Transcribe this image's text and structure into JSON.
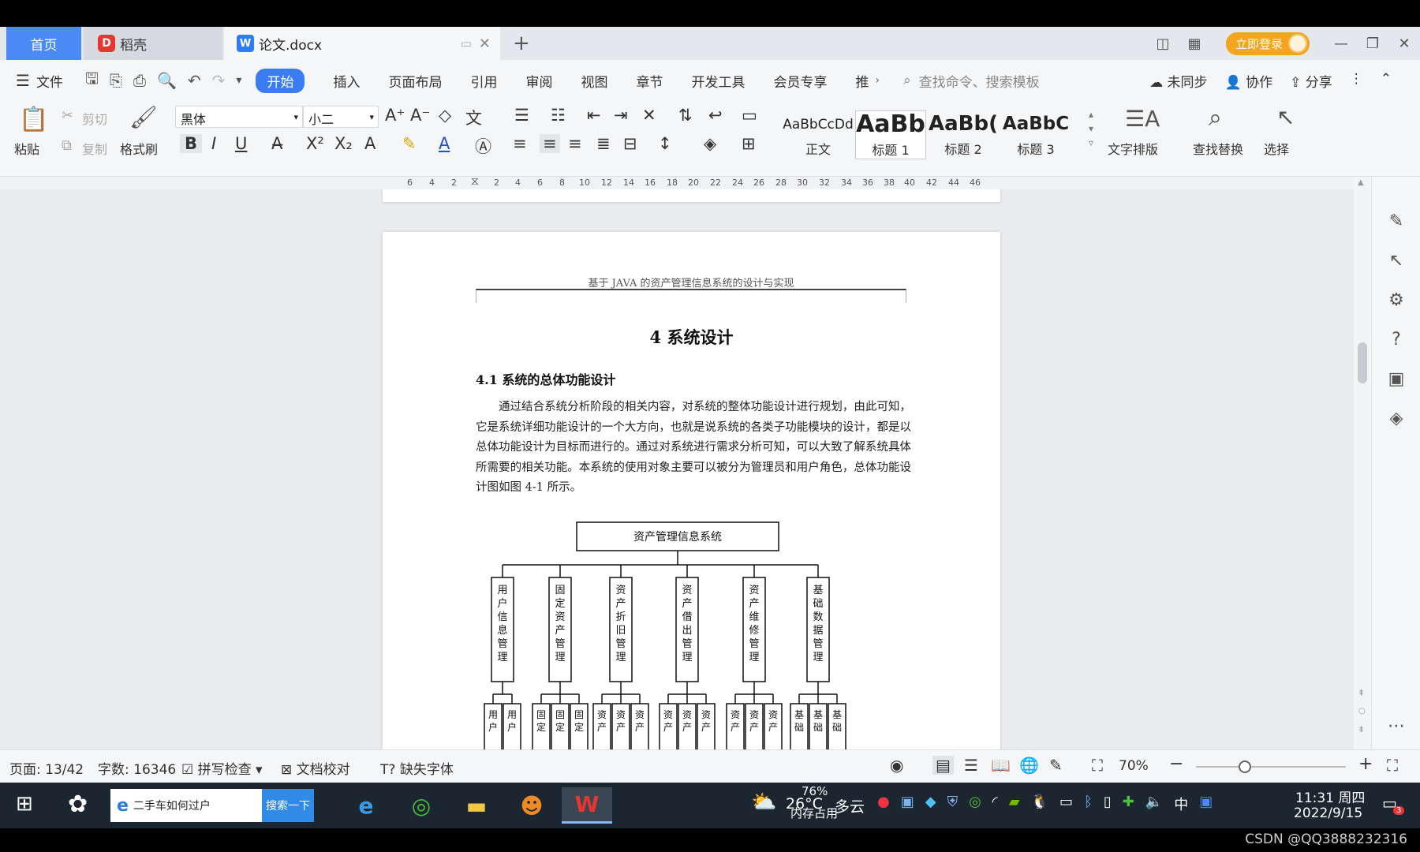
{
  "tabs": {
    "home": "首页",
    "daoke": "稻壳",
    "doc": "论文.docx",
    "login": "立即登录"
  },
  "menu": {
    "file": "文件",
    "items": [
      "开始",
      "插入",
      "页面布局",
      "引用",
      "审阅",
      "视图",
      "章节",
      "开发工具",
      "会员专享",
      "推"
    ],
    "search_placeholder": "查找命令、搜索模板",
    "unsynced": "未同步",
    "collab": "协作",
    "share": "分享"
  },
  "ribbon": {
    "paste": "粘贴",
    "cut": "剪切",
    "copy": "复制",
    "format_painter": "格式刷",
    "font_family": "黑体",
    "font_size": "小二",
    "styles": [
      {
        "sample": "AaBbCcDd",
        "caption": "正文"
      },
      {
        "sample": "AaBb",
        "caption": "标题 1"
      },
      {
        "sample": "AaBb(",
        "caption": "标题 2"
      },
      {
        "sample": "AaBbC",
        "caption": "标题 3"
      }
    ],
    "text_layout": "文字排版",
    "find_replace": "查找替换",
    "select": "选择"
  },
  "ruler": [
    "6",
    "4",
    "2",
    "2",
    "4",
    "6",
    "8",
    "10",
    "12",
    "14",
    "16",
    "18",
    "20",
    "22",
    "24",
    "26",
    "28",
    "30",
    "32",
    "34",
    "36",
    "38",
    "40",
    "42",
    "44",
    "46"
  ],
  "document": {
    "header": "基于 JAVA 的资产管理信息系统的设计与实现",
    "chapter_title": "4  系统设计",
    "section_title": "4.1  系统的总体功能设计",
    "paragraph": "通过结合系统分析阶段的相关内容，对系统的整体功能设计进行规划，由此可知，它是系统详细功能设计的一个大方向，也就是说系统的各类子功能模块的设计，都是以总体功能设计为目标而进行的。通过对系统进行需求分析可知，可以大致了解系统具体所需要的相关功能。本系统的使用对象主要可以被分为管理员和用户角色，总体功能设计图如图 4-1 所示。",
    "org_chart": {
      "root": "资产管理信息系统",
      "children": [
        "用户信息管理",
        "固定资产管理",
        "资产折旧管理",
        "资产借出管理",
        "资产维修管理",
        "基础数据管理"
      ],
      "leaf_prefixes": [
        [
          "用户",
          "用户"
        ],
        [
          "固定",
          "固定",
          "固定"
        ],
        [
          "资产",
          "资产",
          "资产"
        ],
        [
          "资产",
          "资产",
          "资产"
        ],
        [
          "资产",
          "资产",
          "资产"
        ],
        [
          "基础",
          "基础",
          "基础"
        ]
      ]
    }
  },
  "status": {
    "page": "页面: 13/42",
    "words": "字数: 16346",
    "spell": "拼写检查",
    "proof": "文档校对",
    "missing_font": "缺失字体",
    "zoom": "70%"
  },
  "taskbar": {
    "search_text": "二手车如何过户",
    "search_button": "搜索一下",
    "temp": "26°C",
    "weather": "多云",
    "memory_pct": "76%",
    "memory_label": "内存占用",
    "time": "11:31 周四",
    "date": "2022/9/15",
    "ime": "中",
    "notif_count": "3"
  },
  "watermark": "CSDN @QQ3888232316",
  "colors": {
    "accent": "#3b7df0",
    "home_tab": "#4a8af4",
    "login": "#f4a41d",
    "taskbar": "#1c2631"
  }
}
